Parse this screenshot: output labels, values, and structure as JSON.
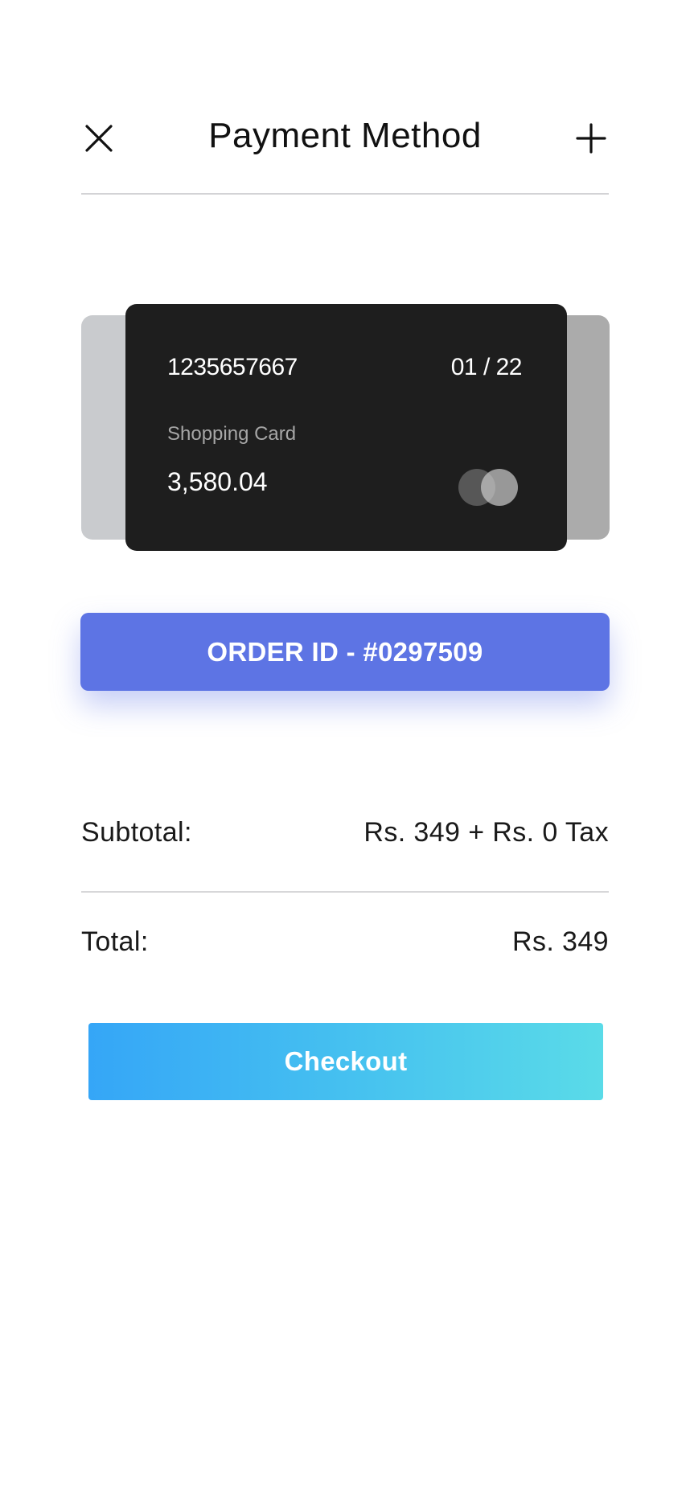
{
  "header": {
    "title": "Payment Method",
    "close_icon": "close-icon",
    "add_icon": "plus-icon"
  },
  "card": {
    "number": "1235657667",
    "expiry": "01 / 22",
    "name": "Shopping Card",
    "balance": "3,580.04",
    "logo_icon": "card-network-icon",
    "color": "#1e1e1e"
  },
  "order": {
    "label": "ORDER ID - #0297509",
    "color": "#5d74e4"
  },
  "summary": {
    "subtotal_label": "Subtotal:",
    "subtotal_value": "Rs. 349 + Rs. 0 Tax",
    "total_label": "Total:",
    "total_value": "Rs. 349"
  },
  "checkout": {
    "label": "Checkout",
    "gradient_start": "#35a6f7",
    "gradient_end": "#5adbe8"
  }
}
